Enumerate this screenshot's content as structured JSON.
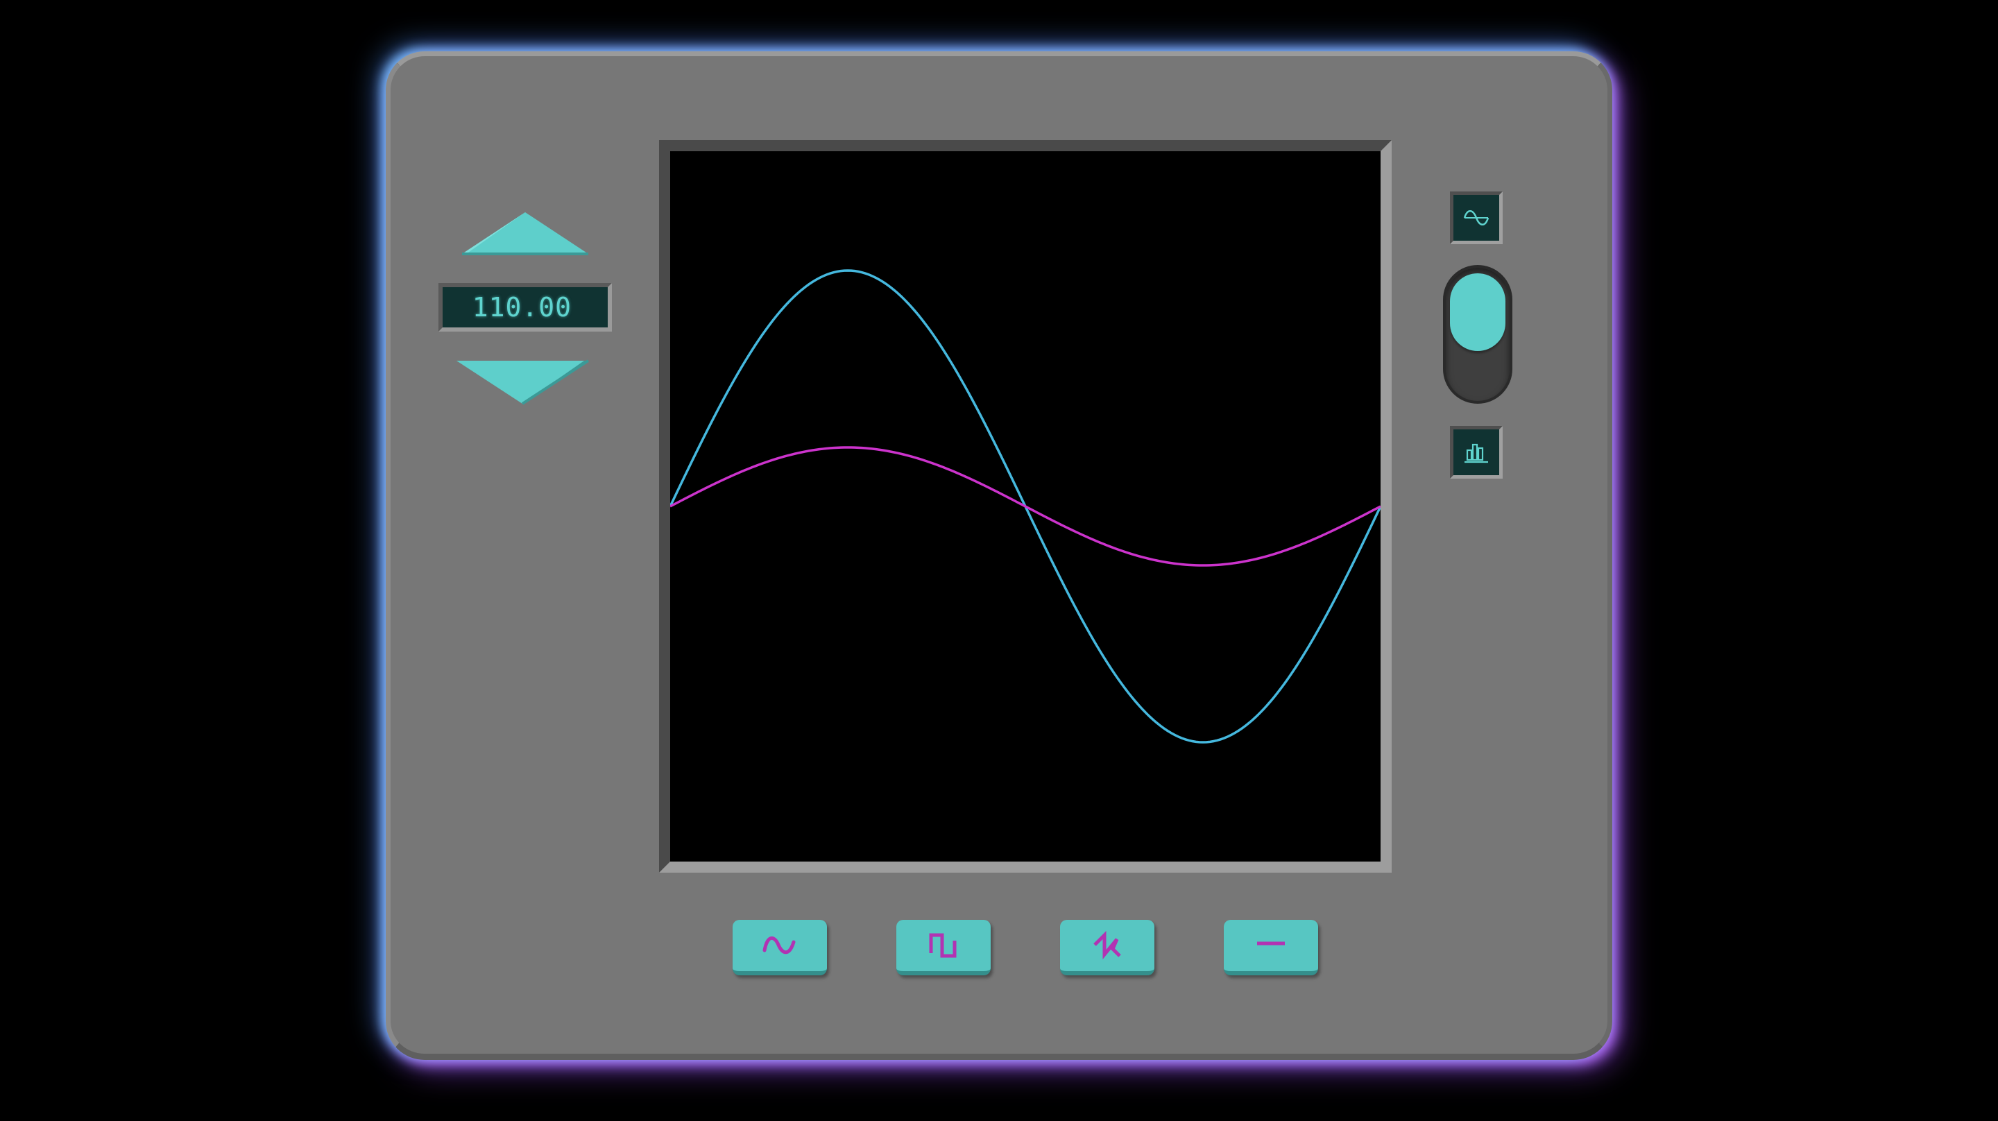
{
  "display": {
    "frequency_readout": "110.00"
  },
  "controls": {
    "increase_icon": "triangle-up-icon",
    "decrease_icon": "triangle-down-icon",
    "view_buttons": [
      {
        "name": "waveform-view",
        "icon": "sine-wave-icon"
      },
      {
        "name": "spectrum-view",
        "icon": "bar-chart-icon"
      }
    ],
    "view_toggle": {
      "position": "waveform-view"
    },
    "waveform_buttons": [
      {
        "name": "sine",
        "icon": "sine-wave-icon"
      },
      {
        "name": "square",
        "icon": "square-wave-icon"
      },
      {
        "name": "sawtooth",
        "icon": "sawtooth-wave-icon"
      },
      {
        "name": "flat",
        "icon": "flat-line-icon"
      }
    ]
  },
  "colors": {
    "panel": "#777777",
    "accent_teal": "#57c6c2",
    "trace_cyan": "#45b8de",
    "trace_magenta": "#cc33cc",
    "icon_magenta": "#b233b2",
    "screen_bg": "#000000",
    "glow_blue": "#78beff",
    "glow_purple": "#be6eff"
  },
  "oscilloscope": {
    "traces": [
      {
        "color": "#45b8de",
        "waveform": "sine",
        "cycles": 1,
        "amplitude": 1.0
      },
      {
        "color": "#cc33cc",
        "waveform": "sine",
        "cycles": 1,
        "amplitude": 0.25
      }
    ]
  }
}
